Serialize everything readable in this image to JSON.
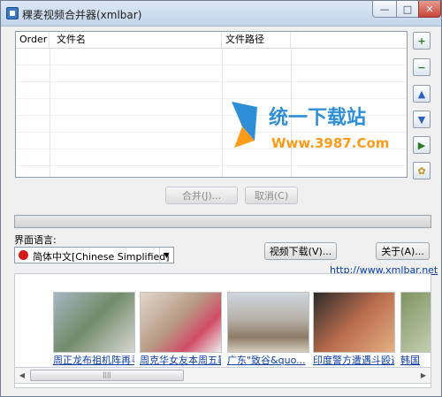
{
  "window": {
    "title": "稞麦视频合并器(xmlbar)"
  },
  "title_buttons": {
    "minimize": "—",
    "maximize": "□",
    "close": "✕"
  },
  "grid": {
    "columns": [
      "Order",
      "文件名",
      "文件路径",
      ""
    ]
  },
  "watermark": {
    "line1": "统一下载站",
    "line2": "Www.3987.Com"
  },
  "side_buttons": [
    {
      "name": "add",
      "glyph": "+"
    },
    {
      "name": "remove",
      "glyph": "−"
    },
    {
      "name": "up",
      "glyph": "▲"
    },
    {
      "name": "down",
      "glyph": "▼"
    },
    {
      "name": "start",
      "glyph": "▶"
    },
    {
      "name": "settings",
      "glyph": "✿"
    }
  ],
  "actions": {
    "merge": "合并(J)...",
    "cancel": "取消(C)"
  },
  "language": {
    "label": "界面语言:",
    "selected": "简体中文[Chinese Simplified]"
  },
  "buttons": {
    "video_download": "视频下载(V)...",
    "about": "关于(A)..."
  },
  "site_link": "http://www.xmlbar.net",
  "news": [
    {
      "caption": "周正龙布祖机阵再寻..."
    },
    {
      "caption": "周克华女友本周五暑..."
    },
    {
      "caption": "广东\"致谷&quo..."
    },
    {
      "caption": "印度警方遭遇斗殴遇..."
    },
    {
      "caption": "韩国"
    }
  ],
  "scrollbar": {
    "left": "◀",
    "right": "▶",
    "grip": "||||"
  },
  "colors": {
    "accent_blue": "#2f8fd6",
    "watermark_orange": "#ff9b1a",
    "link": "#0b3da8"
  }
}
